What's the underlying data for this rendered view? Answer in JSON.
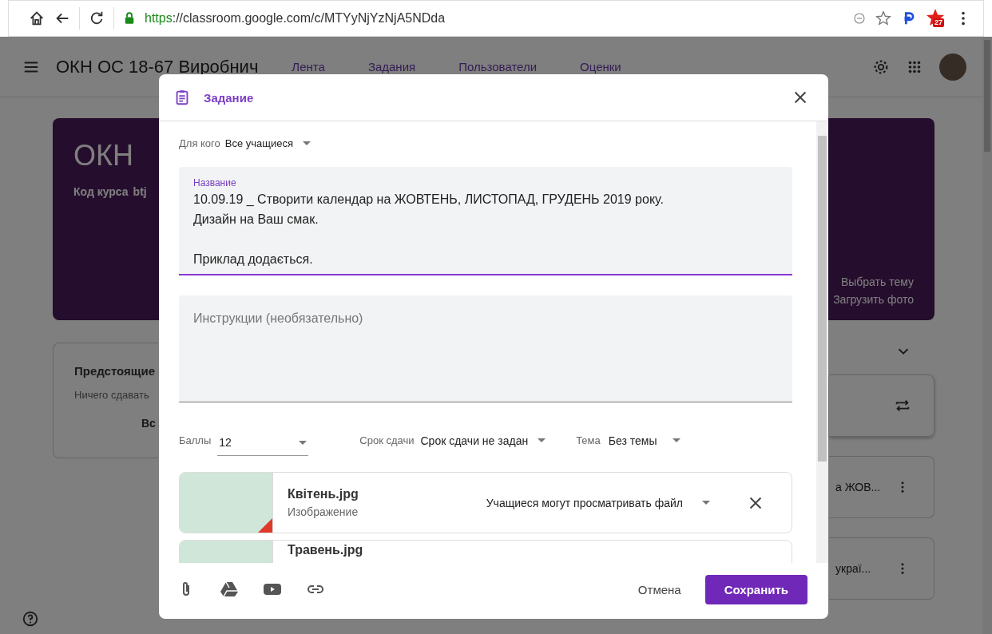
{
  "browser": {
    "url_scheme": "https",
    "url_rest": "://classroom.google.com/c/MTYyNjYzNjA5NDda",
    "extension_badge": "27"
  },
  "header": {
    "course": "ОКН ОС 18-67 Виробнич",
    "tabs": [
      "Лента",
      "Задания",
      "Пользователи",
      "Оценки"
    ]
  },
  "banner": {
    "title": "ОКН",
    "code_label": "Код курса",
    "code": "btj",
    "theme_link": "Выбрать тему",
    "upload_link": "Загрузить фото"
  },
  "upcoming": {
    "title": "Предстоящие",
    "text": "Ничего сдавать",
    "link": "Вс"
  },
  "stream_posts": [
    "а ЖОВ...",
    "украї..."
  ],
  "dialog": {
    "title": "Задание",
    "audience": {
      "label": "Для кого",
      "value": "Все учащиеся"
    },
    "title_field": {
      "label": "Название",
      "paragraphs": [
        [
          "10.09.19 _ Створити календар на ЖОВТЕНЬ, ЛИСТОПАД, ГРУДЕНЬ 2019 року.",
          "Дизайн на Ваш смак."
        ],
        [
          "Приклад додається."
        ]
      ]
    },
    "instructions": {
      "placeholder": "Инструкции (необязательно)"
    },
    "points": {
      "label": "Баллы",
      "value": "12"
    },
    "due": {
      "label": "Срок сдачи",
      "value": "Срок сдачи не задан"
    },
    "topic": {
      "label": "Тема",
      "value": "Без темы"
    },
    "attachments": [
      {
        "name": "Квітень.jpg",
        "type": "Изображение",
        "permission": "Учащиеся могут просматривать файл"
      },
      {
        "name": "Травень.jpg"
      }
    ],
    "cancel": "Отмена",
    "save": "Сохранить"
  }
}
